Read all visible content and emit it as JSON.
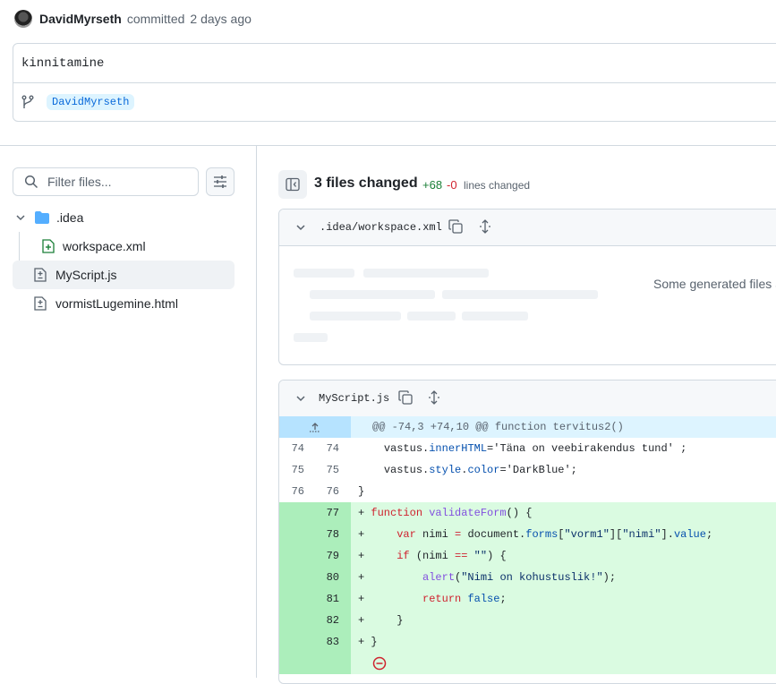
{
  "commit": {
    "author": "DavidMyrseth",
    "action": "committed",
    "time": "2 days ago",
    "message": "kinnitamine",
    "branch": "DavidMyrseth"
  },
  "filter": {
    "placeholder": "Filter files..."
  },
  "tree": {
    "folder": ".idea",
    "folder_child": "workspace.xml",
    "files": [
      "MyScript.js",
      "vormistLugemine.html"
    ]
  },
  "summary": {
    "files_changed": "3 files changed",
    "additions": "+68",
    "deletions": "-0",
    "lines_label": "lines changed"
  },
  "file1": {
    "name": ".idea/workspace.xml",
    "note": "Some generated files a"
  },
  "file2": {
    "name": "MyScript.js",
    "hunk": "@@ -74,3 +74,10 @@ function tervitus2()",
    "lines": [
      {
        "old": "74",
        "new": "74"
      },
      {
        "old": "75",
        "new": "75"
      },
      {
        "old": "76",
        "new": "76"
      },
      {
        "old": "",
        "new": "77"
      },
      {
        "old": "",
        "new": "78"
      },
      {
        "old": "",
        "new": "79"
      },
      {
        "old": "",
        "new": "80"
      },
      {
        "old": "",
        "new": "81"
      },
      {
        "old": "",
        "new": "82"
      },
      {
        "old": "",
        "new": "83"
      }
    ],
    "code": {
      "l74_obj": "vastus.",
      "l74_prop": "innerHTML",
      "l74_rest": "='Täna on veebirakendus tund' ;",
      "l75_obj": "vastus.",
      "l75_prop": "style",
      "l75_dot": ".",
      "l75_prop2": "color",
      "l75_rest": "='DarkBlue';",
      "l76": "}",
      "l77_kw": "function",
      "l77_fn": "validateForm",
      "l77_rest": "() {",
      "l78_kw": "var",
      "l78_a": " nimi ",
      "l78_eq": "=",
      "l78_b": " document.",
      "l78_prop": "forms",
      "l78_c": "[",
      "l78_s1": "\"vorm1\"",
      "l78_d": "][",
      "l78_s2": "\"nimi\"",
      "l78_e": "].",
      "l78_prop2": "value",
      "l78_f": ";",
      "l79_kw": "if",
      "l79_a": " (nimi ",
      "l79_eq": "==",
      "l79_b": " ",
      "l79_s": "\"\"",
      "l79_c": ") {",
      "l80_fn": "alert",
      "l80_a": "(",
      "l80_s": "\"Nimi on kohustuslik!\"",
      "l80_b": ");",
      "l81_kw": "return",
      "l81_b": " ",
      "l81_v": "false",
      "l81_c": ";",
      "l82": "}",
      "l83": "}"
    }
  }
}
